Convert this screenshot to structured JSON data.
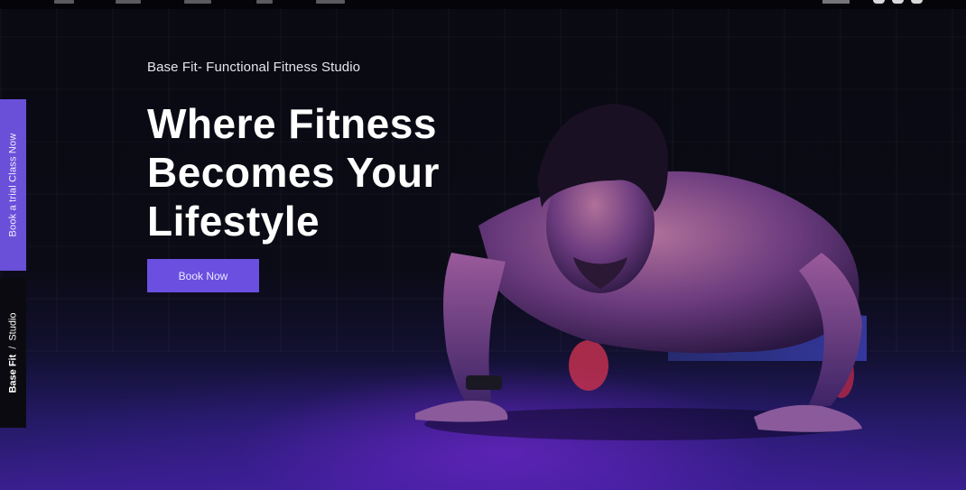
{
  "side": {
    "cta_label": "Book a trial Class Now",
    "brand_primary": "Base Fit",
    "brand_separator": "/",
    "brand_secondary": "Studio"
  },
  "hero": {
    "eyebrow": "Base Fit- Functional Fitness Studio",
    "headline_line1": "Where Fitness",
    "headline_line2": "Becomes Your",
    "headline_line3": "Lifestyle",
    "cta_label": "Book Now",
    "image_subject": "man-doing-pushup-photo"
  },
  "colors": {
    "accent": "#6a4fe0",
    "background": "#0a0a12",
    "floor_glow": "#3a1f8f"
  },
  "icons": [
    "user-icon"
  ]
}
